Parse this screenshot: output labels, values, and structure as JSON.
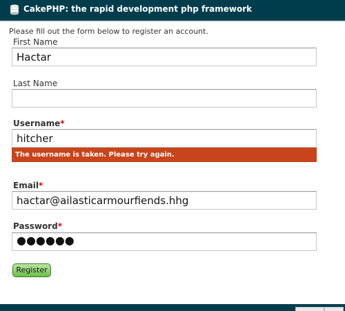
{
  "header": {
    "title": "CakePHP: the rapid development php framework"
  },
  "intro": "Please fill out the form below to register an account.",
  "form": {
    "first_name": {
      "label": "First Name",
      "value": "Hactar"
    },
    "last_name": {
      "label": "Last Name",
      "value": ""
    },
    "username": {
      "label": "Username",
      "required_marker": "*",
      "value": "hitcher",
      "error": "The username is taken. Please try again."
    },
    "email": {
      "label": "Email",
      "required_marker": "*",
      "value": "hactar@ailasticarmourfiends.hhg"
    },
    "password": {
      "label": "Password",
      "required_marker": "*",
      "masked_value": "●●●●●●"
    },
    "submit_label": "Register"
  },
  "colors": {
    "header_bg": "#003d4c",
    "error_bg": "#c8441a",
    "required_star": "#dd0000",
    "button_green": "#6bbf4a"
  },
  "icons": {
    "logo": "cake-logo-icon"
  }
}
